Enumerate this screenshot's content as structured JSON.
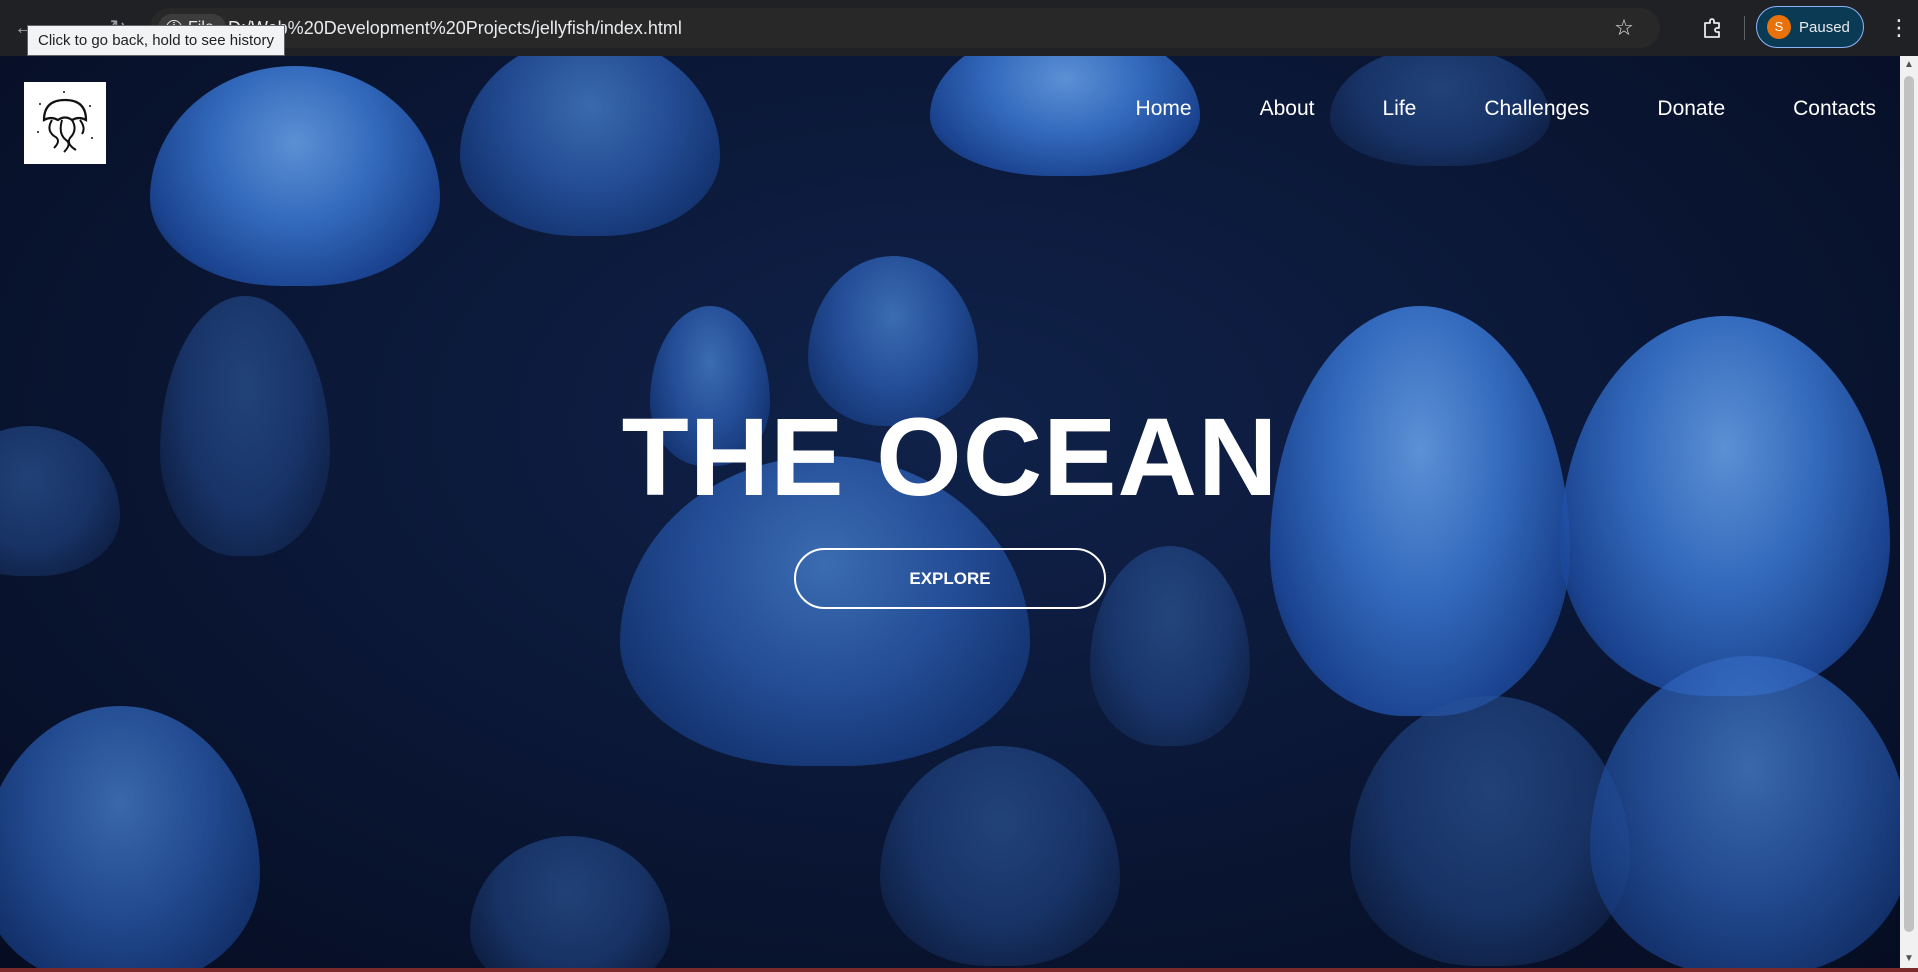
{
  "browser": {
    "back_icon": "arrow-left-icon",
    "forward_icon": "arrow-right-icon",
    "reload_icon": "reload-icon",
    "site_chip_label": "File",
    "url": "D:/Web%20Development%20Projects/jellyfish/index.html",
    "profile_initial": "S",
    "profile_status": "Paused",
    "tooltip": "Click to go back, hold to see history"
  },
  "site": {
    "logo_icon": "jellyfish-logo-icon",
    "nav": [
      {
        "label": "Home"
      },
      {
        "label": "About"
      },
      {
        "label": "Life"
      },
      {
        "label": "Challenges"
      },
      {
        "label": "Donate"
      },
      {
        "label": "Contacts"
      }
    ],
    "hero_title": "THE OCEAN",
    "cta_label": "EXPLORE"
  },
  "colors": {
    "background": "#0a1634",
    "jellyfish": "#3a78d4",
    "text": "#ffffff",
    "profile_accent": "#8ab4f8",
    "avatar": "#e8710a"
  }
}
